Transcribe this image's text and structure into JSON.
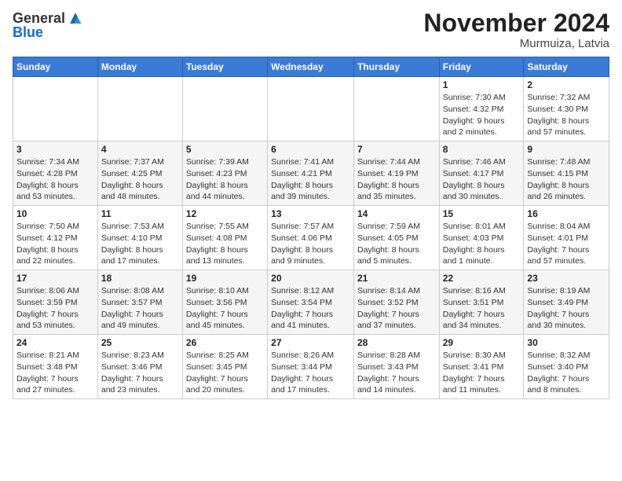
{
  "header": {
    "logo_line1": "General",
    "logo_line2": "Blue",
    "month": "November 2024",
    "location": "Murmuiza, Latvia"
  },
  "weekdays": [
    "Sunday",
    "Monday",
    "Tuesday",
    "Wednesday",
    "Thursday",
    "Friday",
    "Saturday"
  ],
  "weeks": [
    [
      {
        "day": "",
        "info": ""
      },
      {
        "day": "",
        "info": ""
      },
      {
        "day": "",
        "info": ""
      },
      {
        "day": "",
        "info": ""
      },
      {
        "day": "",
        "info": ""
      },
      {
        "day": "1",
        "info": "Sunrise: 7:30 AM\nSunset: 4:32 PM\nDaylight: 9 hours\nand 2 minutes."
      },
      {
        "day": "2",
        "info": "Sunrise: 7:32 AM\nSunset: 4:30 PM\nDaylight: 8 hours\nand 57 minutes."
      }
    ],
    [
      {
        "day": "3",
        "info": "Sunrise: 7:34 AM\nSunset: 4:28 PM\nDaylight: 8 hours\nand 53 minutes."
      },
      {
        "day": "4",
        "info": "Sunrise: 7:37 AM\nSunset: 4:25 PM\nDaylight: 8 hours\nand 48 minutes."
      },
      {
        "day": "5",
        "info": "Sunrise: 7:39 AM\nSunset: 4:23 PM\nDaylight: 8 hours\nand 44 minutes."
      },
      {
        "day": "6",
        "info": "Sunrise: 7:41 AM\nSunset: 4:21 PM\nDaylight: 8 hours\nand 39 minutes."
      },
      {
        "day": "7",
        "info": "Sunrise: 7:44 AM\nSunset: 4:19 PM\nDaylight: 8 hours\nand 35 minutes."
      },
      {
        "day": "8",
        "info": "Sunrise: 7:46 AM\nSunset: 4:17 PM\nDaylight: 8 hours\nand 30 minutes."
      },
      {
        "day": "9",
        "info": "Sunrise: 7:48 AM\nSunset: 4:15 PM\nDaylight: 8 hours\nand 26 minutes."
      }
    ],
    [
      {
        "day": "10",
        "info": "Sunrise: 7:50 AM\nSunset: 4:12 PM\nDaylight: 8 hours\nand 22 minutes."
      },
      {
        "day": "11",
        "info": "Sunrise: 7:53 AM\nSunset: 4:10 PM\nDaylight: 8 hours\nand 17 minutes."
      },
      {
        "day": "12",
        "info": "Sunrise: 7:55 AM\nSunset: 4:08 PM\nDaylight: 8 hours\nand 13 minutes."
      },
      {
        "day": "13",
        "info": "Sunrise: 7:57 AM\nSunset: 4:06 PM\nDaylight: 8 hours\nand 9 minutes."
      },
      {
        "day": "14",
        "info": "Sunrise: 7:59 AM\nSunset: 4:05 PM\nDaylight: 8 hours\nand 5 minutes."
      },
      {
        "day": "15",
        "info": "Sunrise: 8:01 AM\nSunset: 4:03 PM\nDaylight: 8 hours\nand 1 minute."
      },
      {
        "day": "16",
        "info": "Sunrise: 8:04 AM\nSunset: 4:01 PM\nDaylight: 7 hours\nand 57 minutes."
      }
    ],
    [
      {
        "day": "17",
        "info": "Sunrise: 8:06 AM\nSunset: 3:59 PM\nDaylight: 7 hours\nand 53 minutes."
      },
      {
        "day": "18",
        "info": "Sunrise: 8:08 AM\nSunset: 3:57 PM\nDaylight: 7 hours\nand 49 minutes."
      },
      {
        "day": "19",
        "info": "Sunrise: 8:10 AM\nSunset: 3:56 PM\nDaylight: 7 hours\nand 45 minutes."
      },
      {
        "day": "20",
        "info": "Sunrise: 8:12 AM\nSunset: 3:54 PM\nDaylight: 7 hours\nand 41 minutes."
      },
      {
        "day": "21",
        "info": "Sunrise: 8:14 AM\nSunset: 3:52 PM\nDaylight: 7 hours\nand 37 minutes."
      },
      {
        "day": "22",
        "info": "Sunrise: 8:16 AM\nSunset: 3:51 PM\nDaylight: 7 hours\nand 34 minutes."
      },
      {
        "day": "23",
        "info": "Sunrise: 8:19 AM\nSunset: 3:49 PM\nDaylight: 7 hours\nand 30 minutes."
      }
    ],
    [
      {
        "day": "24",
        "info": "Sunrise: 8:21 AM\nSunset: 3:48 PM\nDaylight: 7 hours\nand 27 minutes."
      },
      {
        "day": "25",
        "info": "Sunrise: 8:23 AM\nSunset: 3:46 PM\nDaylight: 7 hours\nand 23 minutes."
      },
      {
        "day": "26",
        "info": "Sunrise: 8:25 AM\nSunset: 3:45 PM\nDaylight: 7 hours\nand 20 minutes."
      },
      {
        "day": "27",
        "info": "Sunrise: 8:26 AM\nSunset: 3:44 PM\nDaylight: 7 hours\nand 17 minutes."
      },
      {
        "day": "28",
        "info": "Sunrise: 8:28 AM\nSunset: 3:43 PM\nDaylight: 7 hours\nand 14 minutes."
      },
      {
        "day": "29",
        "info": "Sunrise: 8:30 AM\nSunset: 3:41 PM\nDaylight: 7 hours\nand 11 minutes."
      },
      {
        "day": "30",
        "info": "Sunrise: 8:32 AM\nSunset: 3:40 PM\nDaylight: 7 hours\nand 8 minutes."
      }
    ]
  ]
}
